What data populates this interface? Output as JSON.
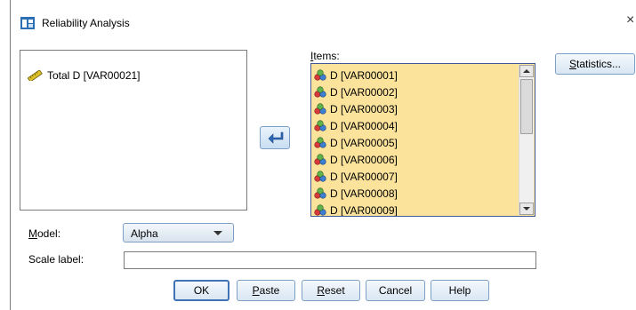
{
  "window": {
    "title": "Reliability Analysis",
    "close_glyph": "×"
  },
  "source_list": {
    "items": [
      {
        "label": "Total D [VAR00021]",
        "icon": "ruler-scale-icon"
      }
    ]
  },
  "items_panel": {
    "label_underlined": "I",
    "label_rest": "tems:",
    "items": [
      {
        "label": "D [VAR00001]",
        "icon": "nominal-variable-icon"
      },
      {
        "label": "D [VAR00002]",
        "icon": "nominal-variable-icon"
      },
      {
        "label": "D [VAR00003]",
        "icon": "nominal-variable-icon"
      },
      {
        "label": "D [VAR00004]",
        "icon": "nominal-variable-icon"
      },
      {
        "label": "D [VAR00005]",
        "icon": "nominal-variable-icon"
      },
      {
        "label": "D [VAR00006]",
        "icon": "nominal-variable-icon"
      },
      {
        "label": "D [VAR00007]",
        "icon": "nominal-variable-icon"
      },
      {
        "label": "D [VAR00008]",
        "icon": "nominal-variable-icon"
      },
      {
        "label": "D [VAR00009]",
        "icon": "nominal-variable-icon"
      }
    ]
  },
  "move_button": {
    "icon": "move-arrow-icon"
  },
  "statistics_button": {
    "label_underlined": "S",
    "label_rest": "tatistics..."
  },
  "model": {
    "label_underlined": "M",
    "label_rest": "odel:",
    "selected": "Alpha"
  },
  "scale_label": {
    "label": "Scale label:",
    "value": ""
  },
  "buttons": {
    "ok": "OK",
    "paste_u": "P",
    "paste_rest": "aste",
    "reset_u": "R",
    "reset_rest": "eset",
    "cancel": "Cancel",
    "help": "Help"
  },
  "colors": {
    "items_background": "#fbe39c",
    "button_border": "#7e9fc6",
    "default_button_border": "#3f73b5"
  }
}
